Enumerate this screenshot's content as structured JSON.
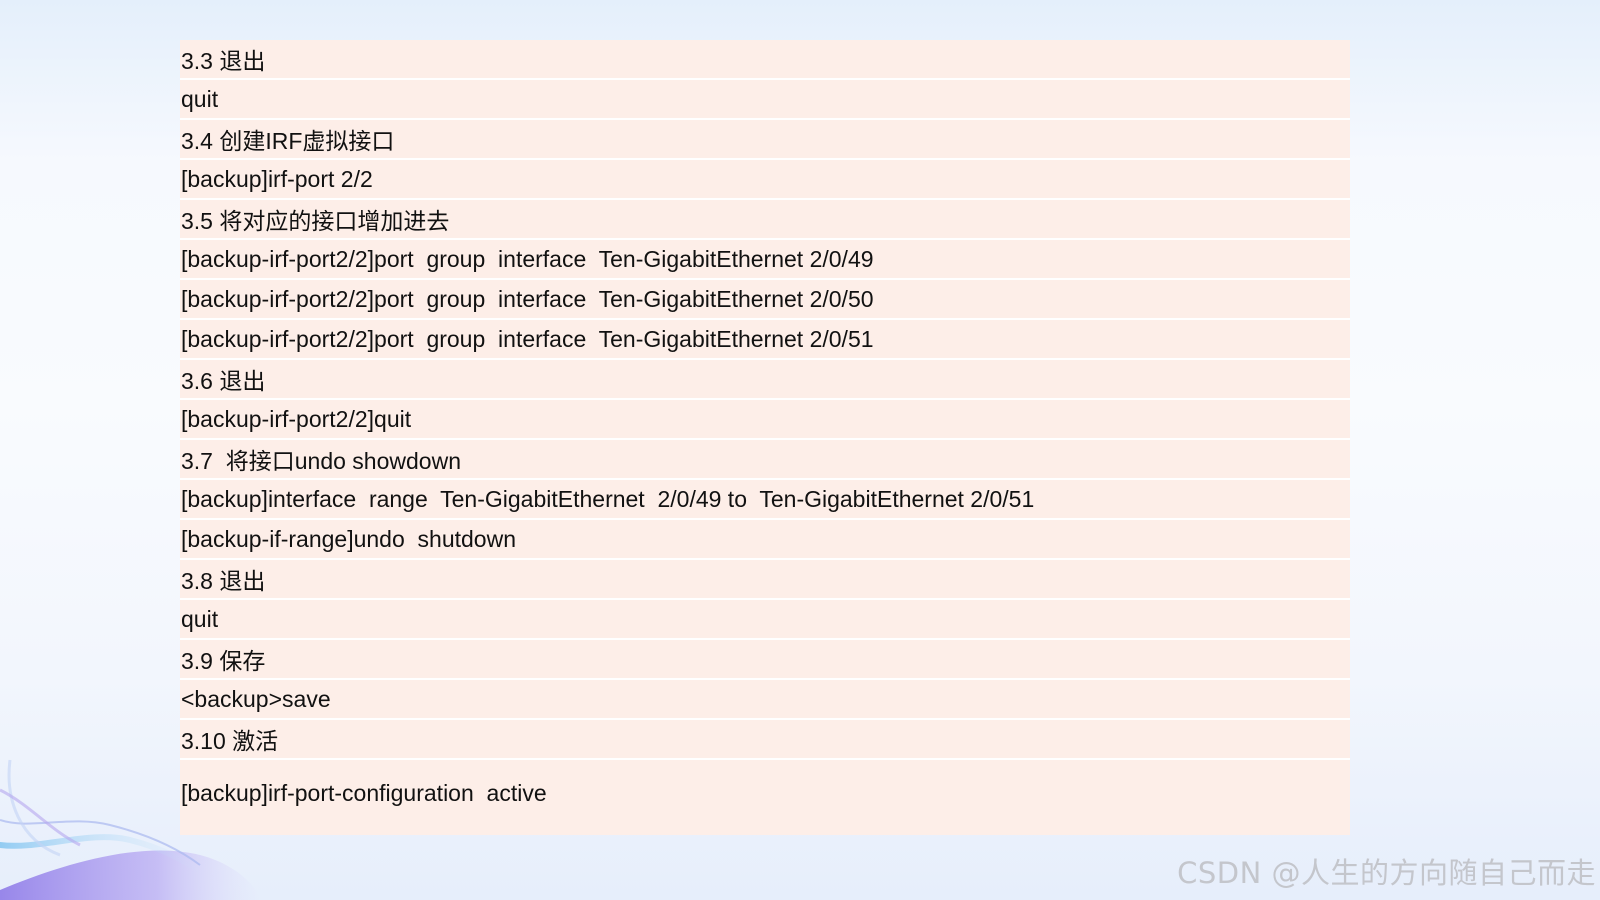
{
  "slide": {
    "lines": [
      "3.3 退出",
      "quit",
      "3.4 创建IRF虚拟接口",
      "[backup]irf-port 2/2",
      "3.5 将对应的接口增加进去",
      "[backup-irf-port2/2]port  group  interface  Ten-GigabitEthernet 2/0/49",
      "[backup-irf-port2/2]port  group  interface  Ten-GigabitEthernet 2/0/50",
      "[backup-irf-port2/2]port  group  interface  Ten-GigabitEthernet 2/0/51",
      "3.6 退出",
      "[backup-irf-port2/2]quit",
      "3.7  将接口undo showdown",
      "[backup]interface  range  Ten-GigabitEthernet  2/0/49 to  Ten-GigabitEthernet 2/0/51",
      "[backup-if-range]undo  shutdown",
      "3.8 退出",
      "quit",
      "3.9 保存",
      "<backup>save",
      "3.10 激活",
      "[backup]irf-port-configuration  active"
    ]
  },
  "watermark": "CSDN @人生的方向随自己而走",
  "colors": {
    "table_background": "#fdeee8",
    "row_divider": "#ffffff",
    "text": "#111111",
    "watermark": "#c4c6cc"
  }
}
